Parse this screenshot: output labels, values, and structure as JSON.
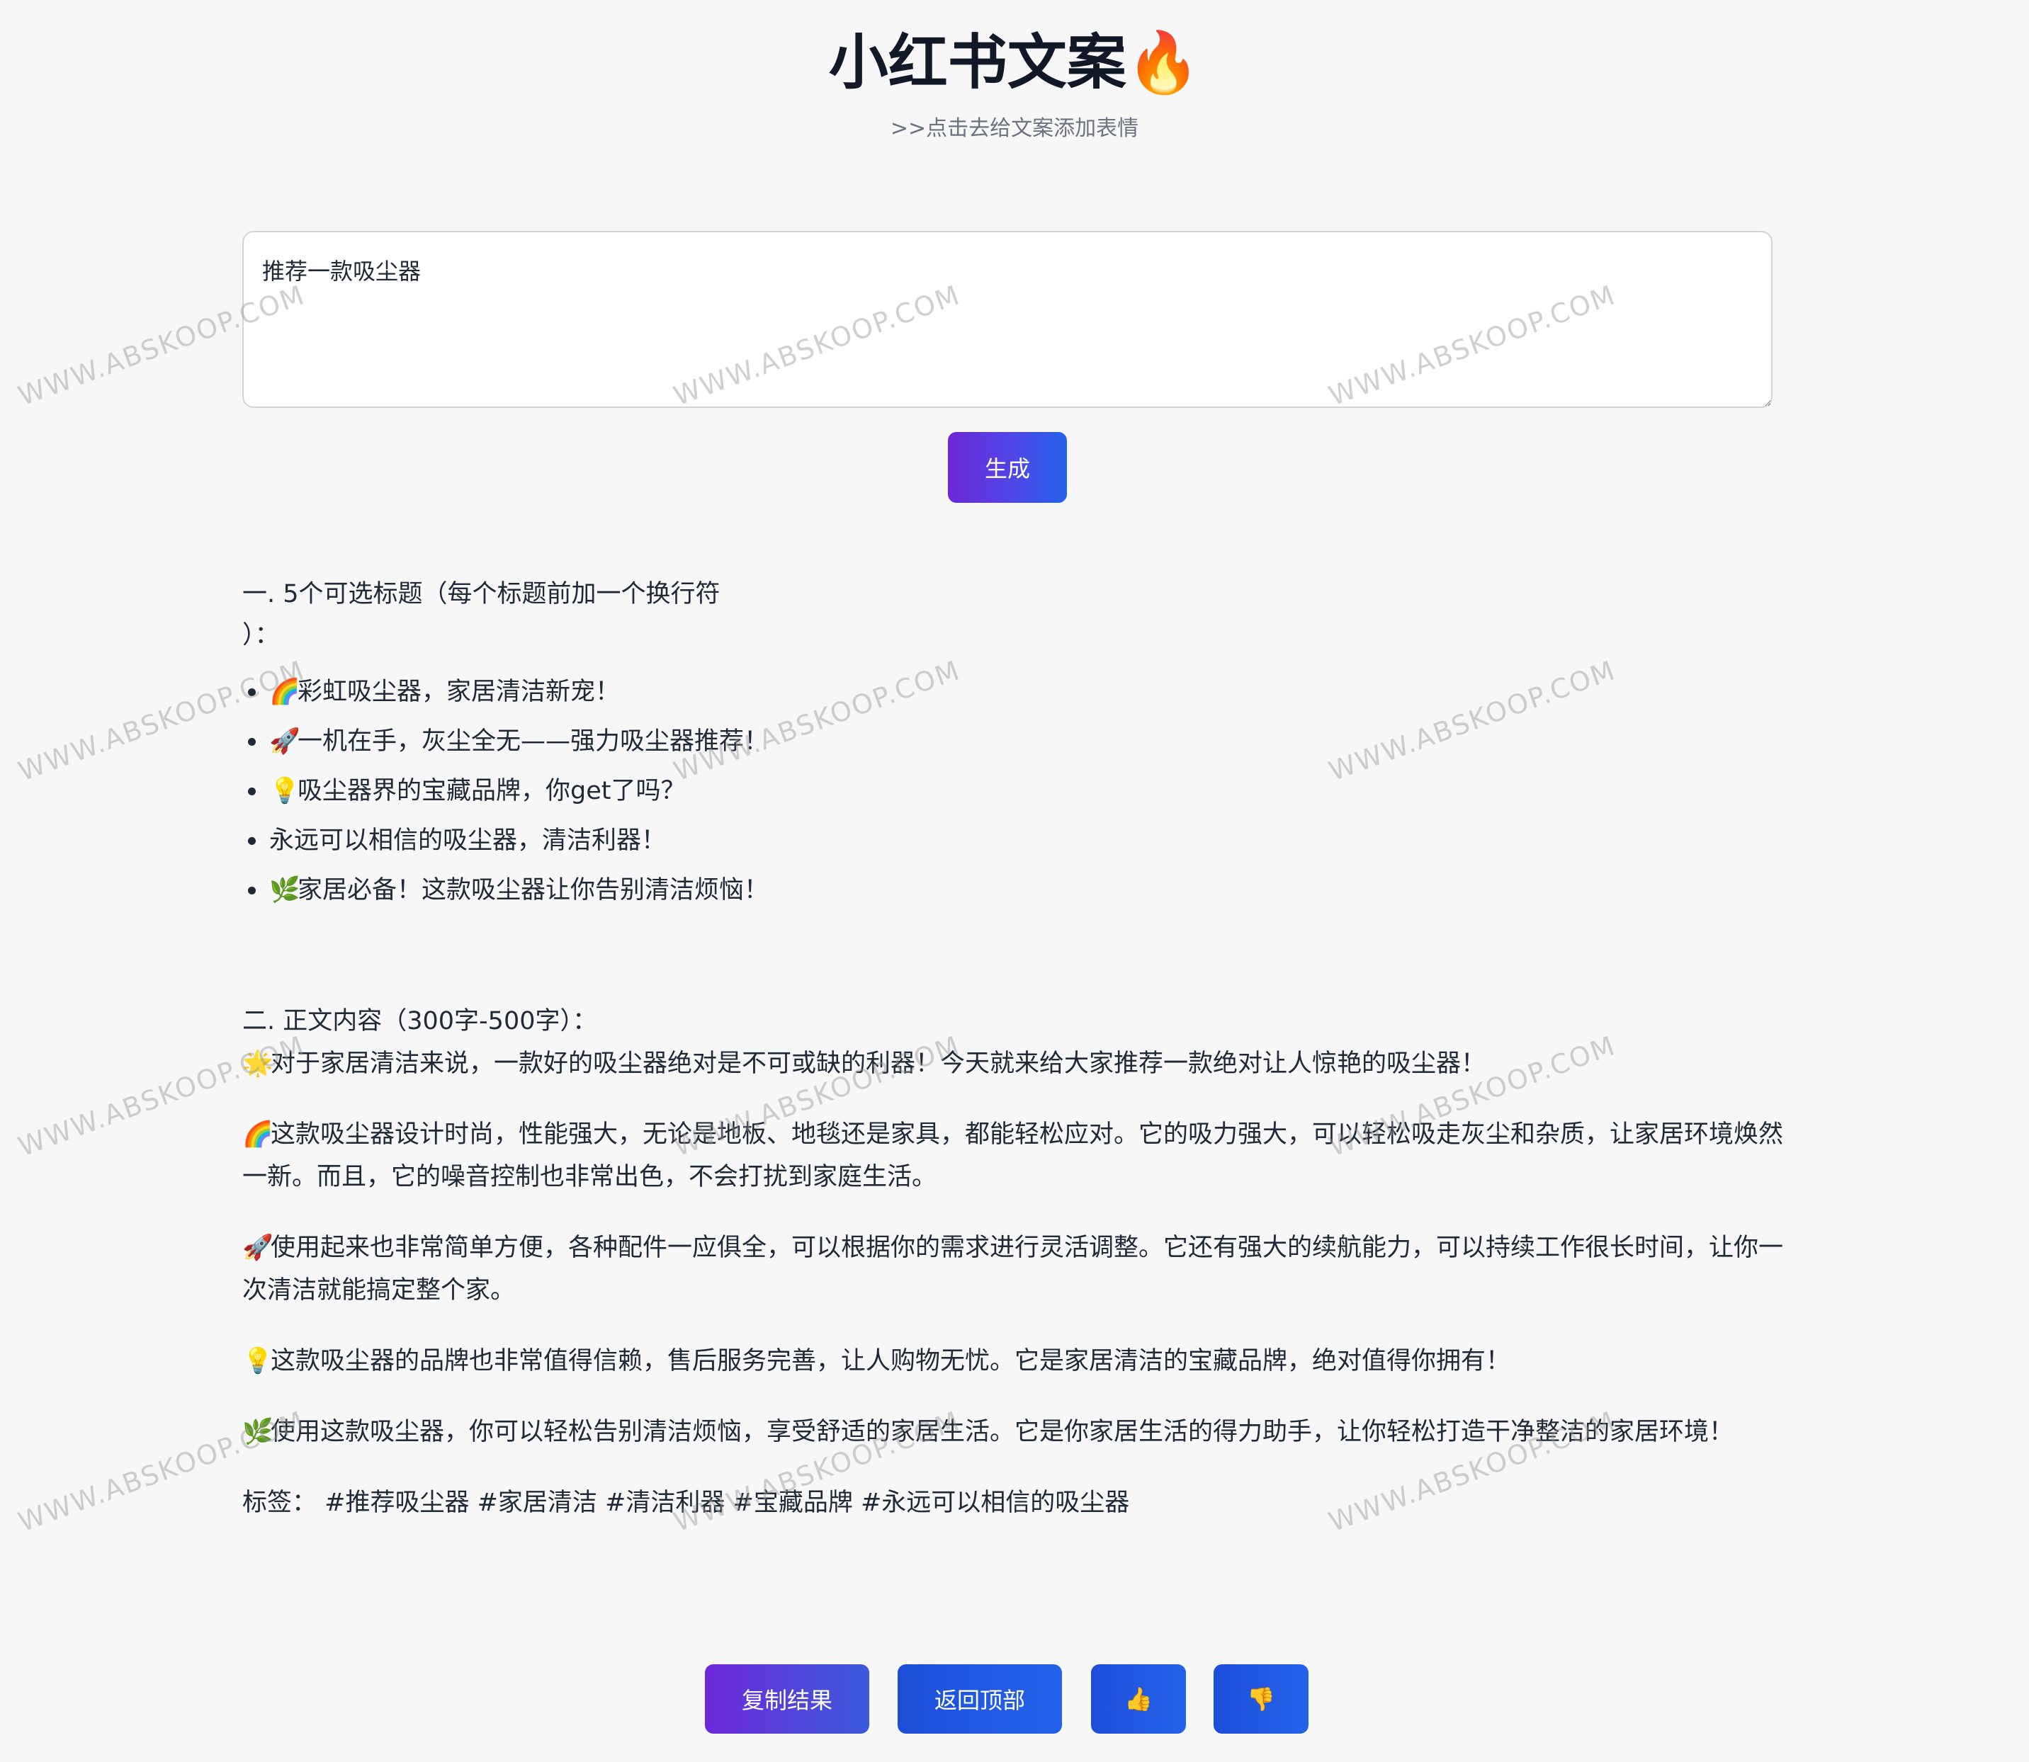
{
  "header": {
    "title": "小红书文案",
    "title_emoji": "🔥",
    "subtitle": ">>点击去给文案添加表情"
  },
  "prompt": {
    "value": "推荐一款吸尘器"
  },
  "generate_button": "生成",
  "result": {
    "section1_heading_line1": "一. 5个可选标题（每个标题前加一个换行符",
    "section1_heading_line2": "）：",
    "titles": [
      {
        "emoji": "🌈",
        "text": "彩虹吸尘器，家居清洁新宠！"
      },
      {
        "emoji": "🚀",
        "text": "一机在手，灰尘全无——强力吸尘器推荐！"
      },
      {
        "emoji": "💡",
        "text": "吸尘器界的宝藏品牌，你get了吗？"
      },
      {
        "emoji": "",
        "text": "永远可以相信的吸尘器，清洁利器！"
      },
      {
        "emoji": "🌿",
        "text": "家居必备！这款吸尘器让你告别清洁烦恼！"
      }
    ],
    "section2_heading": "二. 正文内容（300字-500字）：",
    "paragraphs": [
      {
        "emoji": "🌟",
        "text": "对于家居清洁来说，一款好的吸尘器绝对是不可或缺的利器！今天就来给大家推荐一款绝对让人惊艳的吸尘器！"
      },
      {
        "emoji": "🌈",
        "text": "这款吸尘器设计时尚，性能强大，无论是地板、地毯还是家具，都能轻松应对。它的吸力强大，可以轻松吸走灰尘和杂质，让家居环境焕然一新。而且，它的噪音控制也非常出色，不会打扰到家庭生活。"
      },
      {
        "emoji": "🚀",
        "text": "使用起来也非常简单方便，各种配件一应俱全，可以根据你的需求进行灵活调整。它还有强大的续航能力，可以持续工作很长时间，让你一次清洁就能搞定整个家。"
      },
      {
        "emoji": "💡",
        "text": "这款吸尘器的品牌也非常值得信赖，售后服务完善，让人购物无忧。它是家居清洁的宝藏品牌，绝对值得你拥有！"
      },
      {
        "emoji": "🌿",
        "text": "使用这款吸尘器，你可以轻松告别清洁烦恼，享受舒适的家居生活。它是你家居生活的得力助手，让你轻松打造干净整洁的家居环境！"
      }
    ],
    "tags_label": "标签：",
    "tags": "#推荐吸尘器 #家居清洁 #清洁利器 #宝藏品牌 #永远可以相信的吸尘器"
  },
  "actions": {
    "copy": "复制结果",
    "back_to_top": "返回顶部",
    "thumbs_up": "👍",
    "thumbs_down": "👎"
  },
  "watermark": "WWW.ABSKOOP.COM"
}
